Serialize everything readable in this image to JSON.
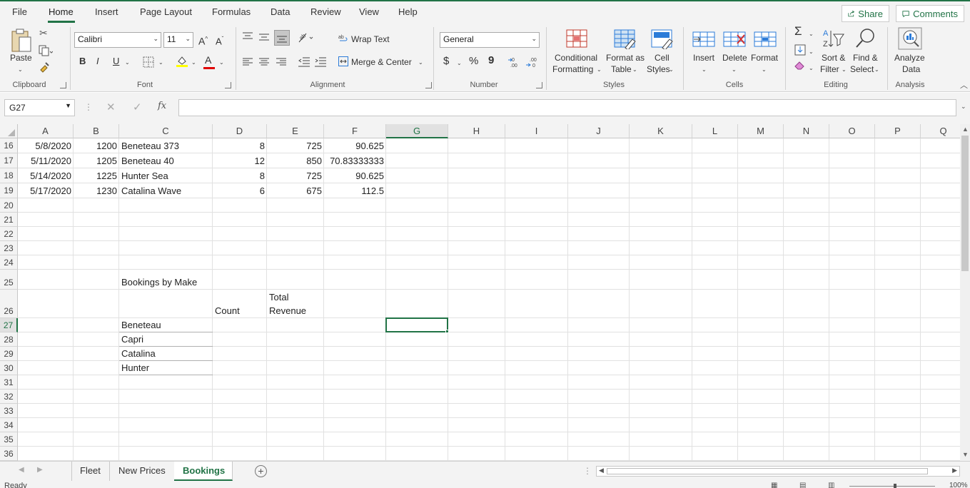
{
  "menu": {
    "tabs": [
      "File",
      "Home",
      "Insert",
      "Page Layout",
      "Formulas",
      "Data",
      "Review",
      "View",
      "Help"
    ],
    "active": "Home",
    "share": "Share",
    "comments": "Comments"
  },
  "ribbon": {
    "clipboard": {
      "paste": "Paste",
      "group": "Clipboard"
    },
    "font": {
      "name": "Calibri",
      "size": "11",
      "bold": "B",
      "italic": "I",
      "underline": "U",
      "grow": "A",
      "shrink": "A",
      "color_a": "A",
      "group": "Font"
    },
    "alignment": {
      "wrap": "Wrap Text",
      "merge": "Merge & Center",
      "group": "Alignment"
    },
    "number": {
      "format": "General",
      "currency": "$",
      "percent": "%",
      "comma": "9",
      "group": "Number"
    },
    "styles": {
      "cond1": "Conditional",
      "cond2": "Formatting",
      "fmt1": "Format as",
      "fmt2": "Table",
      "cell1": "Cell",
      "cell2": "Styles",
      "group": "Styles"
    },
    "cells": {
      "insert": "Insert",
      "delete": "Delete",
      "format": "Format",
      "group": "Cells"
    },
    "editing": {
      "sum": "Σ",
      "sort1": "Sort &",
      "sort2": "Filter",
      "find1": "Find &",
      "find2": "Select",
      "group": "Editing"
    },
    "analysis": {
      "a1": "Analyze",
      "a2": "Data",
      "group": "Analysis"
    }
  },
  "formula_bar": {
    "name_box": "G27",
    "fx": "fx",
    "formula": ""
  },
  "grid": {
    "columns": [
      "A",
      "B",
      "C",
      "D",
      "E",
      "F",
      "G",
      "H",
      "I",
      "J",
      "K",
      "L",
      "M",
      "N",
      "O",
      "P",
      "Q"
    ],
    "selected_column": "G",
    "rows": [
      "16",
      "17",
      "18",
      "19",
      "20",
      "21",
      "22",
      "23",
      "24",
      "25",
      "26",
      "27",
      "28",
      "29",
      "30",
      "31",
      "32",
      "33",
      "34",
      "35",
      "36"
    ],
    "selected_row": "27",
    "data_rows": [
      {
        "a": "5/8/2020",
        "b": "1200",
        "c": "Beneteau 373",
        "d": "8",
        "e": "725",
        "f": "90.625"
      },
      {
        "a": "5/11/2020",
        "b": "1205",
        "c": "Beneteau 40",
        "d": "12",
        "e": "850",
        "f": "70.83333333"
      },
      {
        "a": "5/14/2020",
        "b": "1225",
        "c": "Hunter Sea",
        "d": "8",
        "e": "725",
        "f": "90.625"
      },
      {
        "a": "5/17/2020",
        "b": "1230",
        "c": "Catalina Wave",
        "d": "6",
        "e": "675",
        "f": "112.5"
      }
    ],
    "summary": {
      "title": "Bookings by Make",
      "count_header": "Count",
      "revenue_header_1": "Total",
      "revenue_header_2": "Revenue",
      "makes": [
        "Beneteau",
        "Capri",
        "Catalina",
        "Hunter"
      ]
    }
  },
  "sheets": {
    "tabs": [
      "Fleet",
      "New Prices",
      "Bookings"
    ],
    "active": "Bookings",
    "add": "+"
  },
  "status": {
    "ready": "Ready",
    "zoom": "100%"
  },
  "colors": {
    "accent": "#217346"
  }
}
